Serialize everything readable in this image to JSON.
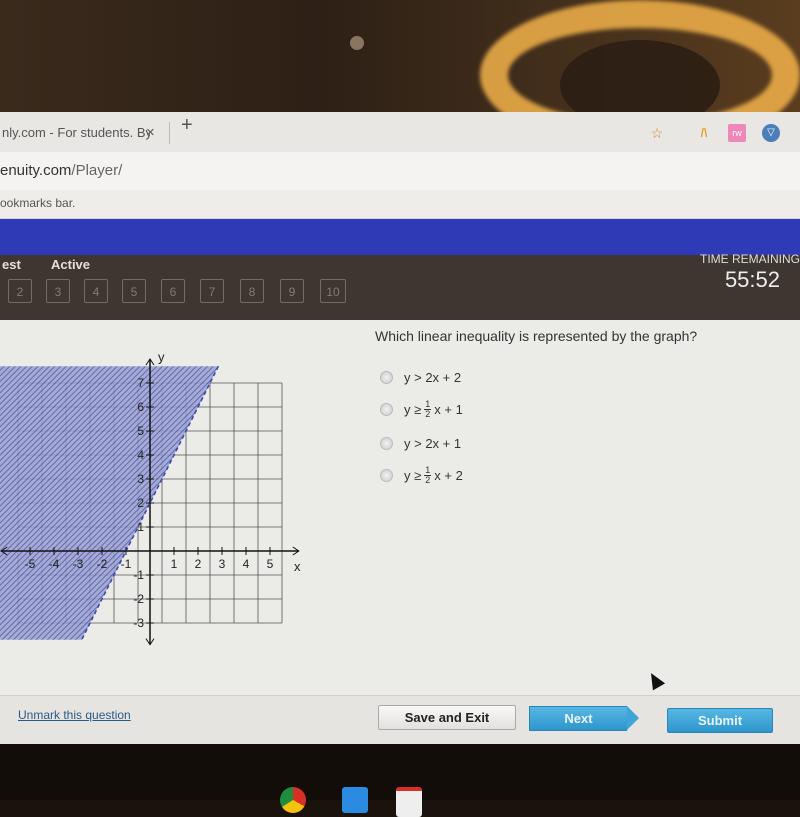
{
  "browser": {
    "tab_title": "nly.com - For students. By st",
    "tab_close": "×",
    "new_tab": "+",
    "url_host": "enuity.com",
    "url_path": "/Player/",
    "bookmarks_bar_text": "ookmarks bar.",
    "extensions": [
      {
        "name": "bookmark-star",
        "glyph": "☆"
      },
      {
        "name": "extension-a",
        "glyph": "/\\"
      },
      {
        "name": "extension-puzzle",
        "glyph": "rw"
      },
      {
        "name": "extension-shield",
        "glyph": "▽"
      }
    ]
  },
  "toolbar": {
    "test_label": "est",
    "status_label": "Active",
    "question_numbers": [
      "2",
      "3",
      "4",
      "5",
      "6",
      "7",
      "8",
      "9",
      "10"
    ],
    "time_remaining_label": "TIME REMAINING",
    "time_remaining": "55:52"
  },
  "question": {
    "prompt": "Which linear inequality is represented by the graph?",
    "options": [
      {
        "lhs": "y > 2x + 2"
      },
      {
        "lhs": "y ≥",
        "frac_num": "1",
        "frac_den": "2",
        "rhs": "x + 1"
      },
      {
        "lhs": "y > 2x + 1"
      },
      {
        "lhs": "y ≥",
        "frac_num": "1",
        "frac_den": "2",
        "rhs": "x + 2"
      }
    ]
  },
  "graph": {
    "x_label": "x",
    "y_label": "y",
    "x_ticks": [
      "-5",
      "-4",
      "-3",
      "-2",
      "-1",
      "1",
      "2",
      "3",
      "4",
      "5"
    ],
    "y_ticks": [
      "7",
      "6",
      "5",
      "4",
      "3",
      "2",
      "1",
      "-1",
      "-2",
      "-3"
    ],
    "x_range": [
      -5,
      5
    ],
    "y_range": [
      -3,
      7
    ],
    "boundary": {
      "slope": 2,
      "intercept": 2,
      "style": "dashed"
    },
    "shaded_side": "above-left",
    "shade_color": "#5b63b0"
  },
  "footer": {
    "unmark_link": "Unmark this question",
    "save_exit": "Save and Exit",
    "next": "Next",
    "submit": "Submit"
  },
  "colors": {
    "banner": "#2f3ab6",
    "toolbar": "#3e3731",
    "primary_button": "#3fa4d6"
  }
}
